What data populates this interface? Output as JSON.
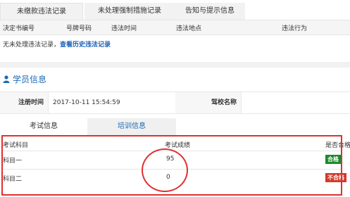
{
  "top_tabs": [
    "未缴款违法记录",
    "未处理强制措施记录",
    "告知与提示信息"
  ],
  "violation_table": {
    "headers": [
      "决定书编号",
      "号牌号码",
      "违法时间",
      "违法地点",
      "违法行为"
    ],
    "empty_text": "无未处理违法记录，",
    "history_link": "查看历史违法记录"
  },
  "student_section": {
    "title": "学员信息",
    "reg_time_label": "注册时间",
    "reg_time_value": "2017-10-11 15:54:59",
    "school_label": "驾校名称",
    "school_value": ""
  },
  "sub_tabs": [
    "考试信息",
    "培训信息"
  ],
  "exam_table": {
    "headers": [
      "考试科目",
      "考试成绩",
      "是否合格"
    ],
    "rows": [
      {
        "subject": "科目一",
        "score": "95",
        "status": "合格"
      },
      {
        "subject": "科目二",
        "score": "0",
        "status": "不合格"
      }
    ]
  },
  "colors": {
    "accent": "#1a6ab5",
    "pass": "#1a8a2a",
    "fail": "#d23a2a",
    "annotation": "#e03030"
  }
}
